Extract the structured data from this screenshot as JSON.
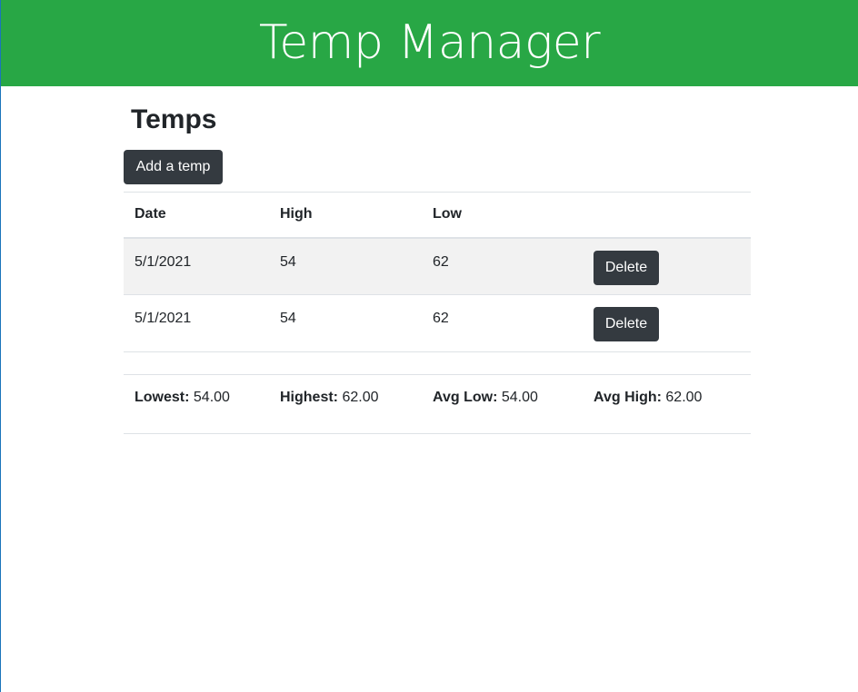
{
  "header": {
    "title": "Temp Manager",
    "background_color": "#28a745"
  },
  "page": {
    "title": "Temps",
    "add_button_label": "Add a temp"
  },
  "table": {
    "columns": [
      "Date",
      "High",
      "Low",
      ""
    ],
    "rows": [
      {
        "date": "5/1/2021",
        "high": "54",
        "low": "62",
        "action_label": "Delete"
      },
      {
        "date": "5/1/2021",
        "high": "54",
        "low": "62",
        "action_label": "Delete"
      }
    ]
  },
  "summary": {
    "lowest_label": "Lowest:",
    "lowest_value": "54.00",
    "highest_label": "Highest:",
    "highest_value": "62.00",
    "avg_low_label": "Avg Low:",
    "avg_low_value": "54.00",
    "avg_high_label": "Avg High:",
    "avg_high_value": "62.00"
  }
}
